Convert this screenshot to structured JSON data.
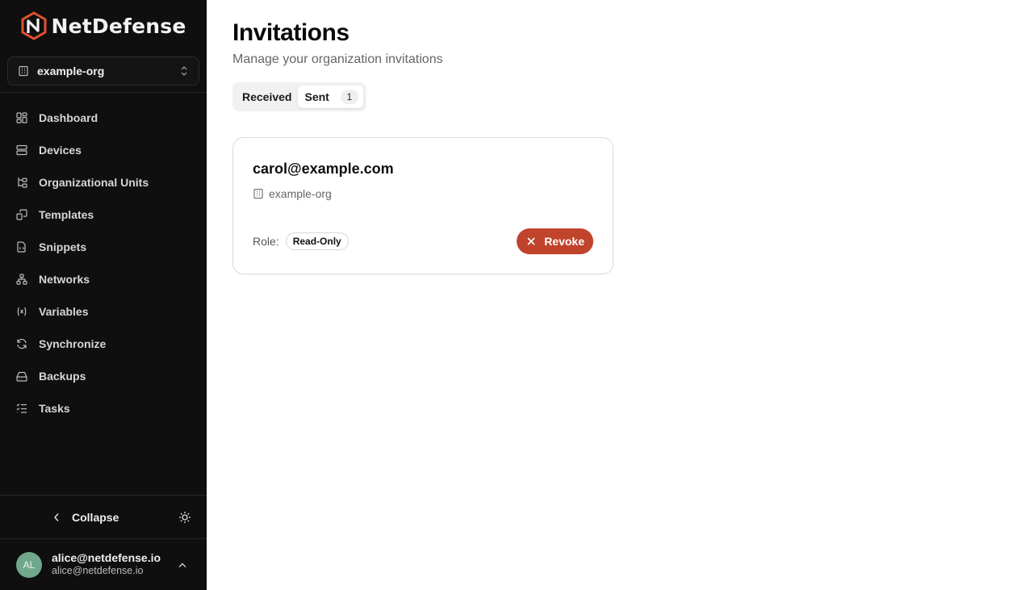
{
  "brand": {
    "name": "NetDefense",
    "accent": "#e0522f"
  },
  "org_selector": {
    "value": "example-org"
  },
  "sidebar": {
    "items": [
      {
        "label": "Dashboard",
        "icon": "dashboard-icon"
      },
      {
        "label": "Devices",
        "icon": "server-icon"
      },
      {
        "label": "Organizational Units",
        "icon": "tree-icon"
      },
      {
        "label": "Templates",
        "icon": "templates-icon"
      },
      {
        "label": "Snippets",
        "icon": "file-code-icon"
      },
      {
        "label": "Networks",
        "icon": "network-icon"
      },
      {
        "label": "Variables",
        "icon": "variable-icon"
      },
      {
        "label": "Synchronize",
        "icon": "refresh-icon"
      },
      {
        "label": "Backups",
        "icon": "hard-drive-icon"
      },
      {
        "label": "Tasks",
        "icon": "list-checks-icon"
      }
    ],
    "collapse_label": "Collapse"
  },
  "user": {
    "initials": "AL",
    "name": "alice@netdefense.io",
    "email": "alice@netdefense.io",
    "avatar_color": "#6fa88c"
  },
  "page": {
    "title": "Invitations",
    "subtitle": "Manage your organization invitations"
  },
  "tabs": [
    {
      "label": "Received",
      "active": false
    },
    {
      "label": "Sent",
      "active": true,
      "count": "1"
    }
  ],
  "invitation": {
    "email": "carol@example.com",
    "org": "example-org",
    "role_label": "Role:",
    "role": "Read-Only",
    "revoke_label": "Revoke",
    "revoke_color": "#c0432b"
  }
}
